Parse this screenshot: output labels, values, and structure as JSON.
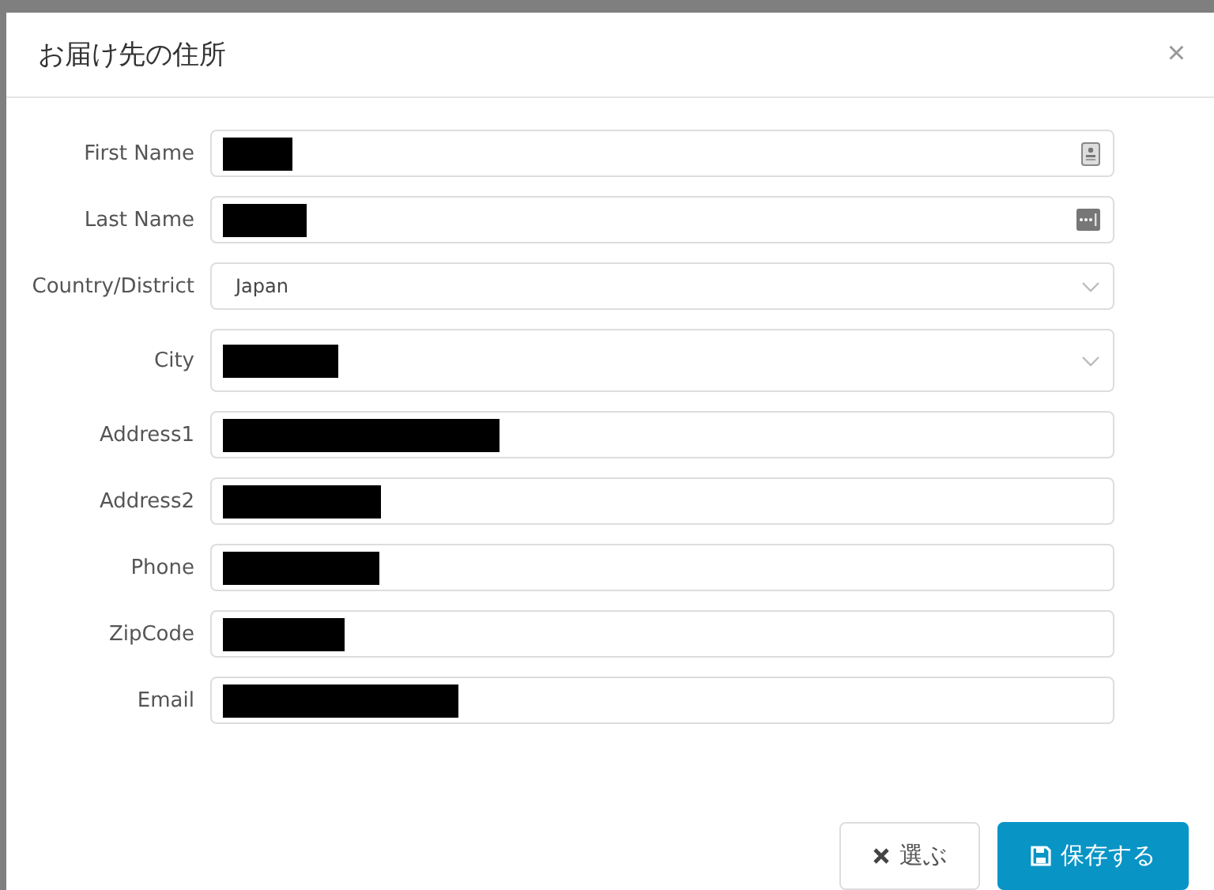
{
  "dialog": {
    "title": "お届け先の住所",
    "close": "×"
  },
  "fields": [
    {
      "label": "First Name",
      "kind": "text",
      "redacted": true
    },
    {
      "label": "Last Name",
      "kind": "text",
      "redacted": true
    },
    {
      "label": "Country/District",
      "kind": "select",
      "value": "Japan"
    },
    {
      "label": "City",
      "kind": "select",
      "redacted": true
    },
    {
      "label": "Address1",
      "kind": "text",
      "redacted": true
    },
    {
      "label": "Address2",
      "kind": "text",
      "redacted": true
    },
    {
      "label": "Phone",
      "kind": "text",
      "redacted": true
    },
    {
      "label": "ZipCode",
      "kind": "text",
      "redacted": true
    },
    {
      "label": "Email",
      "kind": "text",
      "redacted": true
    }
  ],
  "buttons": [
    {
      "label": "選ぶ",
      "kind": "cancel"
    },
    {
      "label": "保存する",
      "kind": "save"
    }
  ]
}
